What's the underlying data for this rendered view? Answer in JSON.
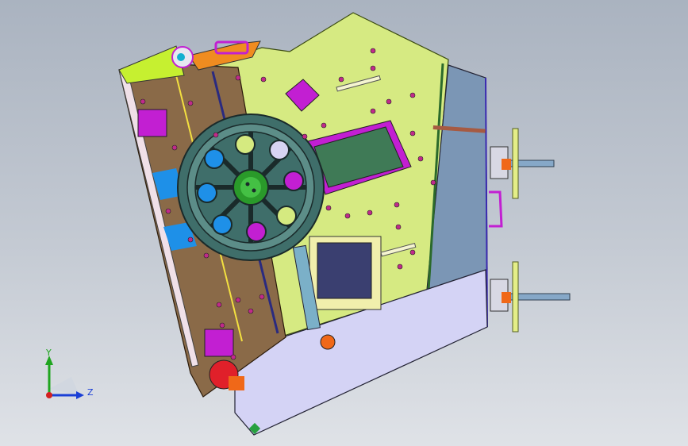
{
  "viewport": {
    "colors": {
      "background_top": "#aab3c0",
      "background_bottom": "#dfe2e7",
      "frame_plate": "#d6ea82",
      "side_panel": "#7b96b5",
      "bottom_panel": "#d4d3f5",
      "jaw_brown": "#8a6a48",
      "flywheel": "#3f6e6a",
      "highlight_magenta": "#c21fd2",
      "blue_strip": "#1e90e8"
    }
  },
  "triad": {
    "y_label": "Y",
    "z_label": "Z",
    "colors": {
      "y": "#1fa51f",
      "z": "#1a3fd6",
      "x": "#d42020"
    }
  }
}
